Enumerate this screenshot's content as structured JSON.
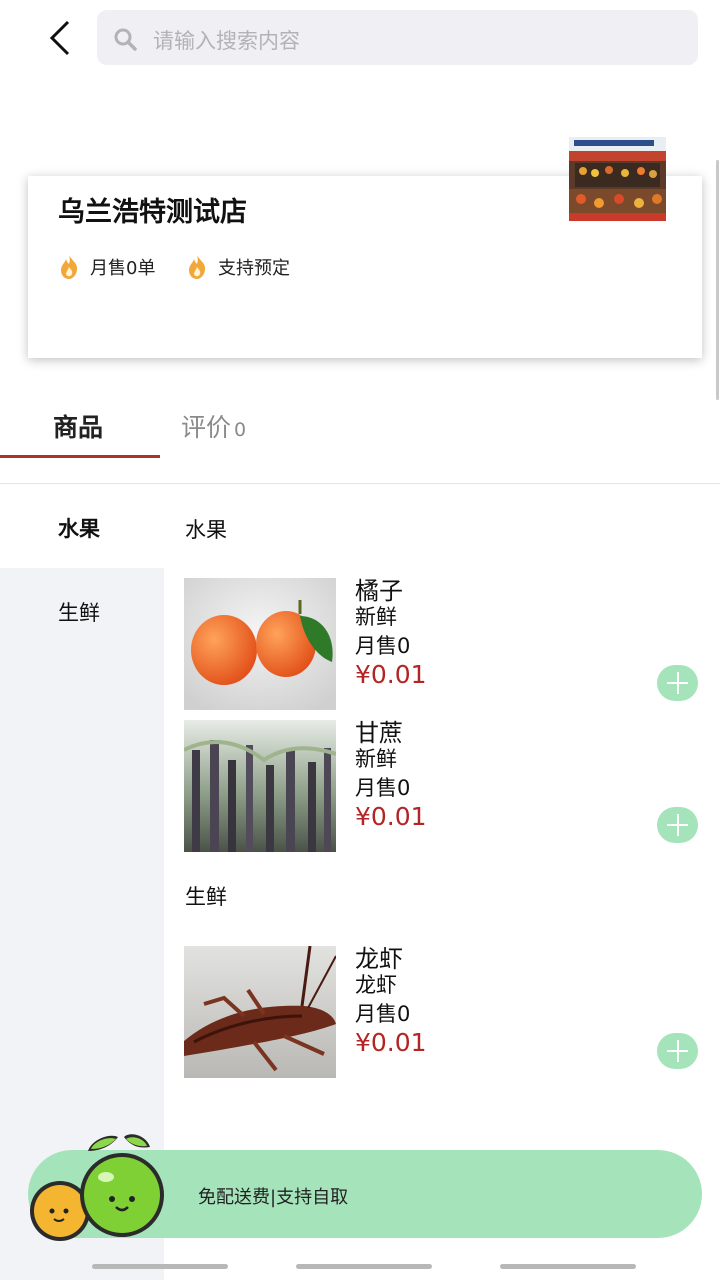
{
  "search": {
    "placeholder": "请输入搜索内容"
  },
  "store": {
    "name": "乌兰浩特测试店",
    "monthly_sales": "月售0单",
    "reservation": "支持预定"
  },
  "tabs": {
    "goods": "商品",
    "reviews": "评价",
    "reviews_count": "0"
  },
  "categories": [
    {
      "label": "水果"
    },
    {
      "label": "生鲜"
    }
  ],
  "sections": [
    {
      "title": "水果"
    },
    {
      "title": "生鲜"
    }
  ],
  "products": [
    {
      "name": "橘子",
      "desc": "新鲜",
      "sales": "月售0",
      "price": "¥0.01"
    },
    {
      "name": "甘蔗",
      "desc": "新鲜",
      "sales": "月售0",
      "price": "¥0.01"
    },
    {
      "name": "龙虾",
      "desc": "龙虾",
      "sales": "月售0",
      "price": "¥0.01"
    }
  ],
  "bottom_bar": {
    "text": "免配送费|支持自取"
  },
  "colors": {
    "accent": "#a8342a",
    "price": "#b32424",
    "green": "#a5e4bb",
    "sidebar_bg": "#f2f3f6"
  },
  "icons": [
    "back-arrow-icon",
    "search-icon",
    "flame-icon",
    "plus-icon",
    "fruit-mascot-icon"
  ]
}
